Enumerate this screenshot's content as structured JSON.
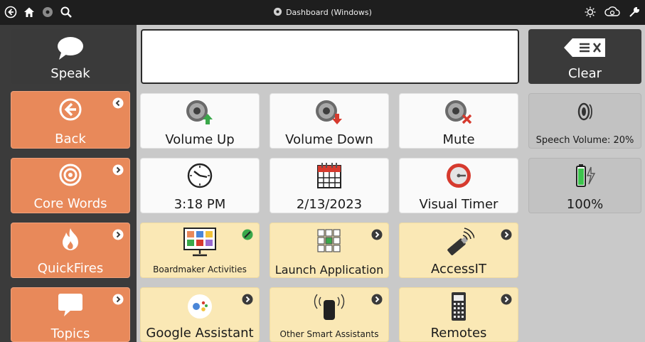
{
  "window": {
    "title": "Dashboard (Windows)"
  },
  "titlebar": {
    "left_icons": [
      "back-circle-icon",
      "home-icon",
      "settings-icon",
      "search-icon"
    ],
    "right_icons": [
      "brightness-icon",
      "cloud-sync-icon",
      "tools-icon"
    ]
  },
  "message_bar": {
    "speak_label": "Speak",
    "clear_label": "Clear",
    "text": ""
  },
  "sidebar": {
    "items": [
      {
        "label": "Back",
        "icon": "back-arrow-icon"
      },
      {
        "label": "Core Words",
        "icon": "target-icon"
      },
      {
        "label": "QuickFires",
        "icon": "fire-icon"
      },
      {
        "label": "Topics",
        "icon": "speech-bubble-icon"
      }
    ]
  },
  "grid": {
    "row1": [
      {
        "label": "Volume Up",
        "icon": "speaker-up-icon"
      },
      {
        "label": "Volume Down",
        "icon": "speaker-down-icon"
      },
      {
        "label": "Mute",
        "icon": "speaker-mute-icon"
      }
    ],
    "row2": [
      {
        "label": "3:18 PM",
        "icon": "clock-icon"
      },
      {
        "label": "2/13/2023",
        "icon": "calendar-icon"
      },
      {
        "label": "Visual Timer",
        "icon": "timer-icon"
      }
    ],
    "row3": [
      {
        "label": "Boardmaker Activities",
        "icon": "boardmaker-icon"
      },
      {
        "label": "Launch Application",
        "icon": "app-grid-icon"
      },
      {
        "label": "AccessIT",
        "icon": "usb-wireless-icon"
      }
    ],
    "row4": [
      {
        "label": "Google Assistant",
        "icon": "google-assistant-icon"
      },
      {
        "label": "Other Smart Assistants",
        "icon": "smart-speaker-icon"
      },
      {
        "label": "Remotes",
        "icon": "remote-icon"
      }
    ]
  },
  "status": {
    "speech_volume_label": "Speech Volume: 20%",
    "battery_label": "100%"
  },
  "colors": {
    "sidebar_orange": "#e8895a",
    "tile_yellow": "#fae8b5",
    "tile_white": "#fafafa",
    "tile_grey": "#c2c2c2",
    "dark": "#3a3a3a"
  }
}
